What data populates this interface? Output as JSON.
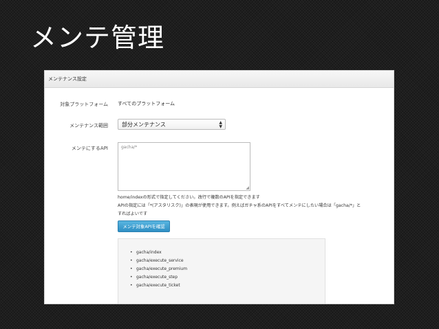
{
  "slide": {
    "title": "メンテ管理"
  },
  "panel": {
    "header": "メンテナンス設定",
    "target_platform": {
      "label": "対象プラットフォーム",
      "value": "すべてのプラットフォーム"
    },
    "maintenance_scope": {
      "label": "メンテナンス範囲",
      "selected": "部分メンテナンス"
    },
    "maintenance_api": {
      "label": "メンテにするAPI",
      "value": "gacha/*"
    },
    "help_lines": [
      "home/indexの形式で指定してください。改行で複数のAPIを指定できます",
      "APIの指定には「*(アスタリスク)」の表現が使用できます。例えばガチャ系のAPIをすべてメンテにしたい場合は「gacha/*」と",
      "すればよいです"
    ],
    "confirm_button": "メンテ対象APIを確認",
    "api_list": [
      "gacha/index",
      "gacha/execute_service",
      "gacha/execute_premium",
      "gacha/execute_step",
      "gacha/execute_ticket"
    ]
  }
}
